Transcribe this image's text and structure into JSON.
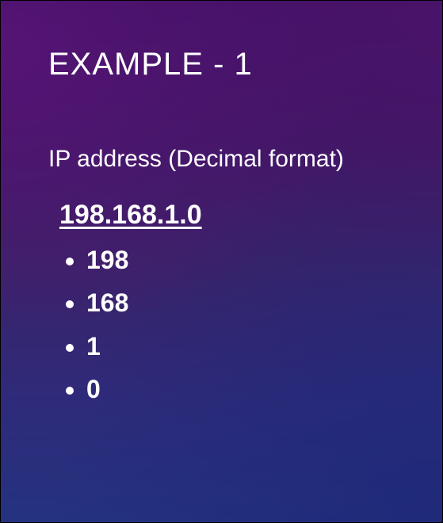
{
  "slide": {
    "title": "EXAMPLE - 1",
    "subtitle": "IP address (Decimal format)",
    "ip_address": "198.168.1.0",
    "octets": [
      "198",
      "168",
      "1",
      "0"
    ]
  }
}
